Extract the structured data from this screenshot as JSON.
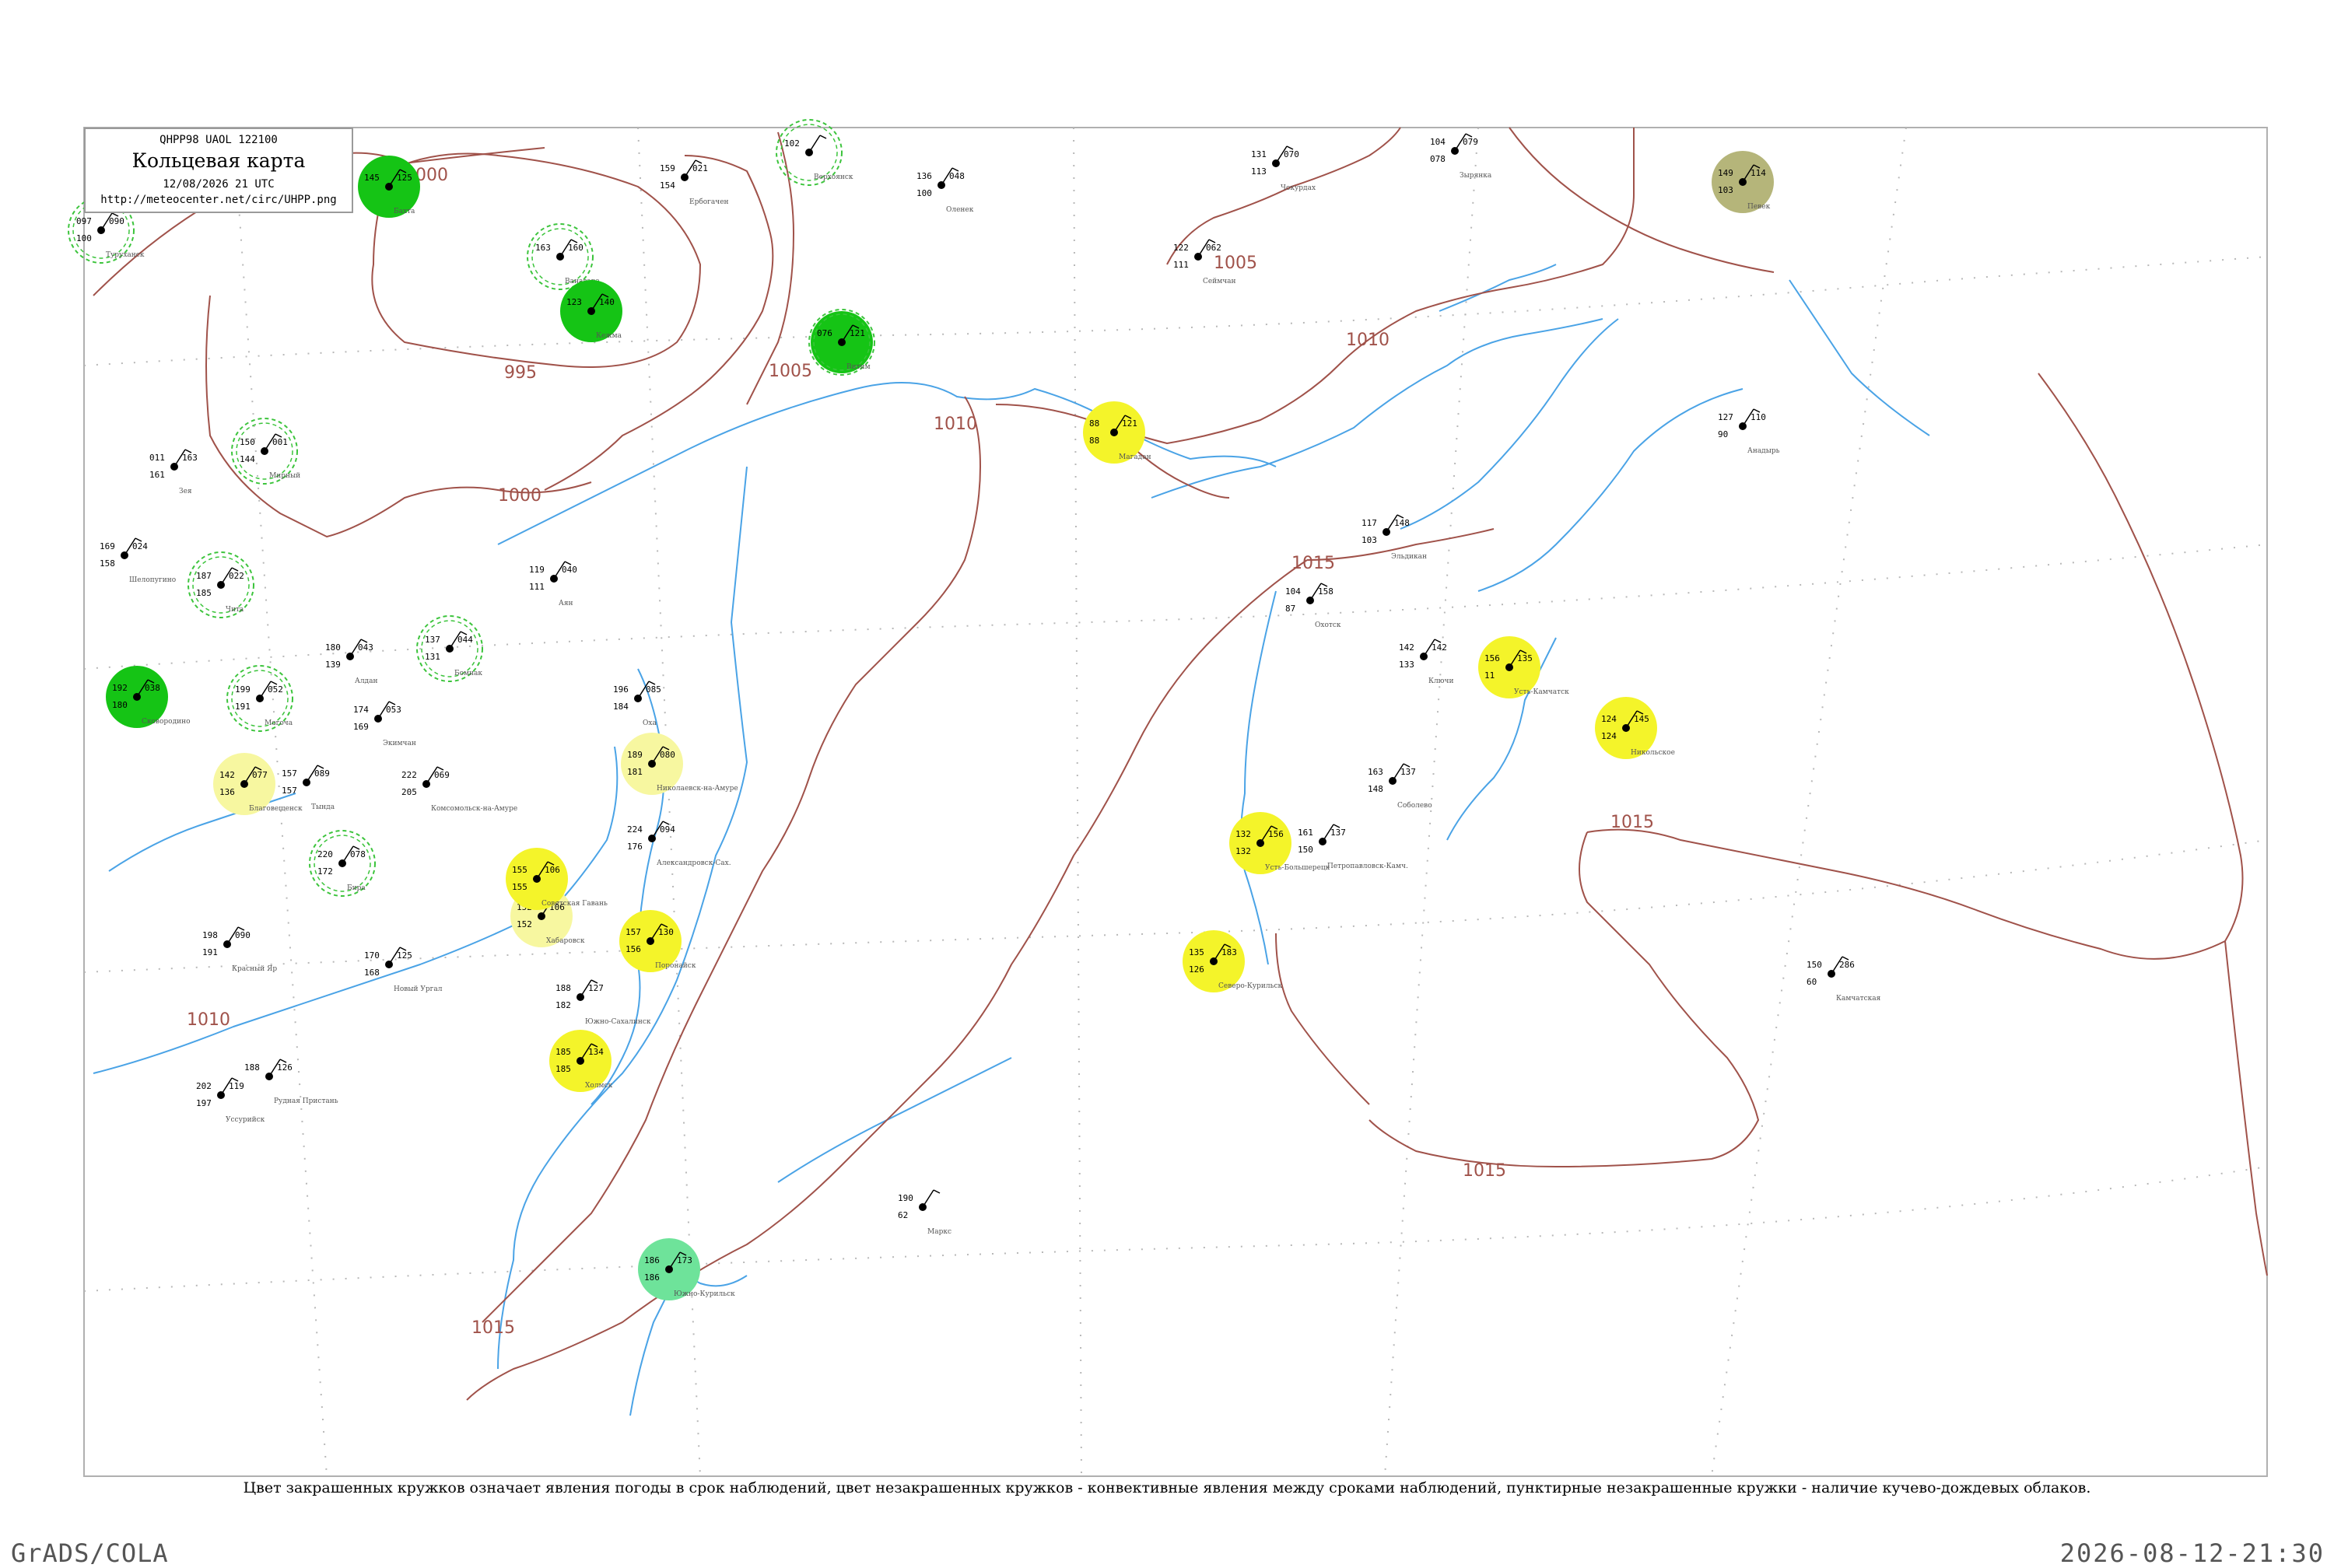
{
  "legend": {
    "code_line": "QHPP98  UAOL  122100",
    "title": "Кольцевая карта",
    "datetime": "12/08/2026 21 UTC",
    "url": "http://meteocenter.net/circ/UHPP.png"
  },
  "caption": "Цвет закрашенных кружков означает явления погоды в срок наблюдений, цвет незакрашенных кружков - конвективные явления между сроками наблюдений, пунктирные незакрашенные кружки - наличие кучево-дождевых облаков.",
  "footer": {
    "left": "GrADS/COLA",
    "right": "2026-08-12-21:30"
  },
  "isobars": [
    "1000",
    "995",
    "1005",
    "1010",
    "1000",
    "1005",
    "1010",
    "1015",
    "1015",
    "1015",
    "1015",
    "1010"
  ],
  "colors": {
    "coast": "#4aa3e6",
    "isobar": "#a0524a",
    "rain_green": "#15c415",
    "fog_yellow": "#f4f42a",
    "light_yellow": "#f7f7a0",
    "mint": "#6ee39a",
    "olive": "#b5b57a",
    "border_frame": "#b0b0b0"
  },
  "stations": [
    {
      "name": "Туруханск",
      "t": "097",
      "p": "090",
      "td": "100",
      "fill": "none",
      "dashed": true
    },
    {
      "name": "Бахта",
      "t": "145",
      "p": "125",
      "td": "",
      "fill": "green",
      "dashed": false
    },
    {
      "name": "Ванавара",
      "t": "163",
      "p": "160",
      "td": "",
      "fill": "none",
      "dashed": true
    },
    {
      "name": "Кежма",
      "t": "123",
      "p": "140",
      "td": "",
      "fill": "green",
      "dashed": false
    },
    {
      "name": "Мирный",
      "t": "150",
      "p": "001",
      "td": "144",
      "fill": "none",
      "dashed": true
    },
    {
      "name": "Витим",
      "t": "076",
      "p": "121",
      "td": "",
      "fill": "green",
      "dashed": true
    },
    {
      "name": "Ербогачен",
      "t": "159",
      "p": "021",
      "td": "154",
      "fill": "none",
      "dashed": false
    },
    {
      "name": "Верхоянск",
      "t": "102",
      "p": "",
      "td": "",
      "fill": "none",
      "dashed": true
    },
    {
      "name": "Оленек",
      "t": "136",
      "p": "048",
      "td": "100",
      "fill": "none",
      "dashed": false
    },
    {
      "name": "Чокурдах",
      "t": "131",
      "p": "070",
      "td": "113",
      "fill": "none",
      "dashed": false
    },
    {
      "name": "Зырянка",
      "t": "104",
      "p": "079",
      "td": "078",
      "fill": "none",
      "dashed": false
    },
    {
      "name": "Певек",
      "t": "149",
      "p": "114",
      "td": "103",
      "fill": "olive",
      "dashed": false
    },
    {
      "name": "Сеймчан",
      "t": "122",
      "p": "062",
      "td": "111",
      "fill": "none",
      "dashed": false
    },
    {
      "name": "Магадан",
      "t": "88",
      "p": "121",
      "td": "88",
      "fill": "yellow",
      "dashed": false
    },
    {
      "name": "Анадырь",
      "t": "127",
      "p": "110",
      "td": "90",
      "fill": "none",
      "dashed": false
    },
    {
      "name": "Усть-Камчатск",
      "t": "156",
      "p": "135",
      "td": "11",
      "fill": "yellow",
      "dashed": false
    },
    {
      "name": "Никольское",
      "t": "124",
      "p": "145",
      "td": "124",
      "fill": "yellow",
      "dashed": false
    },
    {
      "name": "Ключи",
      "t": "142",
      "p": "142",
      "td": "133",
      "fill": "none",
      "dashed": false
    },
    {
      "name": "Петропавловск-Камч.",
      "t": "161",
      "p": "137",
      "td": "150",
      "fill": "none",
      "dashed": false
    },
    {
      "name": "Соболево",
      "t": "163",
      "p": "137",
      "td": "148",
      "fill": "none",
      "dashed": false
    },
    {
      "name": "Усть-Большерецк",
      "t": "132",
      "p": "156",
      "td": "132",
      "fill": "yellow",
      "dashed": false
    },
    {
      "name": "Северо-Курильск",
      "t": "135",
      "p": "183",
      "td": "126",
      "fill": "yellow",
      "dashed": false
    },
    {
      "name": "Южно-Курильск",
      "t": "186",
      "p": "173",
      "td": "186",
      "fill": "mint",
      "dashed": false
    },
    {
      "name": "Николаевск-на-Амуре",
      "t": "189",
      "p": "080",
      "td": "181",
      "fill": "lightyellow",
      "dashed": false
    },
    {
      "name": "Охотск",
      "t": "104",
      "p": "158",
      "td": "87",
      "fill": "none",
      "dashed": false
    },
    {
      "name": "Аян",
      "t": "119",
      "p": "040",
      "td": "111",
      "fill": "none",
      "dashed": false
    },
    {
      "name": "Поронайск",
      "t": "157",
      "p": "130",
      "td": "156",
      "fill": "yellow",
      "dashed": false
    },
    {
      "name": "Холмск",
      "t": "185",
      "p": "134",
      "td": "185",
      "fill": "yellow",
      "dashed": false
    },
    {
      "name": "Хабаровск",
      "t": "152",
      "p": "106",
      "td": "152",
      "fill": "lightyellow",
      "dashed": false
    },
    {
      "name": "Советская Гавань",
      "t": "155",
      "p": "106",
      "td": "155",
      "fill": "yellow",
      "dashed": false
    },
    {
      "name": "Уссурийск",
      "t": "202",
      "p": "119",
      "td": "197",
      "fill": "none",
      "dashed": false
    },
    {
      "name": "Благовещенск",
      "t": "142",
      "p": "077",
      "td": "136",
      "fill": "lightyellow",
      "dashed": false
    },
    {
      "name": "Зея",
      "t": "011",
      "p": "163",
      "td": "161",
      "fill": "none",
      "dashed": false
    },
    {
      "name": "Шелопугино",
      "t": "169",
      "p": "024",
      "td": "158",
      "fill": "none",
      "dashed": false
    },
    {
      "name": "Чита",
      "t": "187",
      "p": "022",
      "td": "185",
      "fill": "none",
      "dashed": true
    },
    {
      "name": "Алдан",
      "t": "180",
      "p": "043",
      "td": "139",
      "fill": "none",
      "dashed": false
    },
    {
      "name": "Бомнак",
      "t": "137",
      "p": "044",
      "td": "131",
      "fill": "none",
      "dashed": true
    },
    {
      "name": "Экимчан",
      "t": "174",
      "p": "053",
      "td": "169",
      "fill": "none",
      "dashed": false
    },
    {
      "name": "Комсомольск-на-Амуре",
      "t": "222",
      "p": "069",
      "td": "205",
      "fill": "none",
      "dashed": false
    },
    {
      "name": "Бира",
      "t": "220",
      "p": "078",
      "td": "172",
      "fill": "none",
      "dashed": true
    },
    {
      "name": "Красный Яр",
      "t": "198",
      "p": "090",
      "td": "191",
      "fill": "none",
      "dashed": false
    },
    {
      "name": "Рудная Пристань",
      "t": "188",
      "p": "126",
      "td": "",
      "fill": "none",
      "dashed": false
    },
    {
      "name": "Маркс",
      "t": "190",
      "p": "",
      "td": "62",
      "fill": "none",
      "dashed": false
    },
    {
      "name": "Камчатская",
      "t": "150",
      "p": "286",
      "td": "60",
      "fill": "none",
      "dashed": false
    },
    {
      "name": "Эльдикан",
      "t": "117",
      "p": "148",
      "td": "103",
      "fill": "none",
      "dashed": false
    },
    {
      "name": "Новый Ургал",
      "t": "170",
      "p": "125",
      "td": "168",
      "fill": "none",
      "dashed": false
    },
    {
      "name": "Оха",
      "t": "196",
      "p": "085",
      "td": "184",
      "fill": "none",
      "dashed": false
    },
    {
      "name": "Александровск-Сах.",
      "t": "224",
      "p": "094",
      "td": "176",
      "fill": "none",
      "dashed": false
    },
    {
      "name": "Южно-Сахалинск",
      "t": "188",
      "p": "127",
      "td": "182",
      "fill": "none",
      "dashed": false
    },
    {
      "name": "Сковородино",
      "t": "192",
      "p": "038",
      "td": "180",
      "fill": "green",
      "dashed": false
    },
    {
      "name": "Могоча",
      "t": "199",
      "p": "052",
      "td": "191",
      "fill": "none",
      "dashed": true
    },
    {
      "name": "Тында",
      "t": "157",
      "p": "089",
      "td": "157",
      "fill": "none",
      "dashed": false
    }
  ]
}
